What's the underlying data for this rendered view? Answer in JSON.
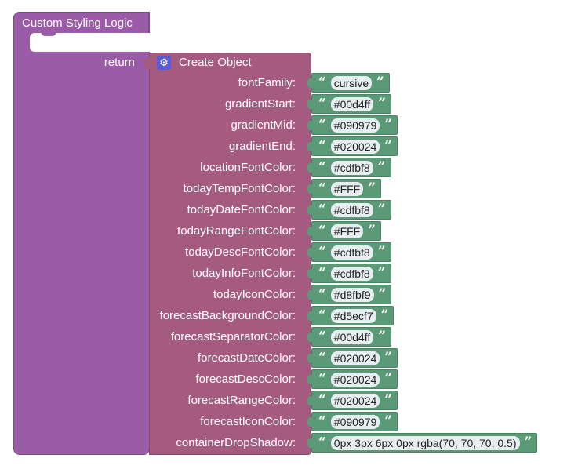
{
  "procedure": {
    "title": "Custom Styling Logic",
    "return_label": "return"
  },
  "object_block": {
    "title": "Create Object",
    "icon": "gear-icon"
  },
  "fields": [
    {
      "key": "fontFamily:",
      "value": "cursive"
    },
    {
      "key": "gradientStart:",
      "value": "#00d4ff"
    },
    {
      "key": "gradientMid:",
      "value": "#090979"
    },
    {
      "key": "gradientEnd:",
      "value": "#020024"
    },
    {
      "key": "locationFontColor:",
      "value": "#cdfbf8"
    },
    {
      "key": "todayTempFontColor:",
      "value": "#FFF"
    },
    {
      "key": "todayDateFontColor:",
      "value": "#cdfbf8"
    },
    {
      "key": "todayRangeFontColor:",
      "value": "#FFF"
    },
    {
      "key": "todayDescFontColor:",
      "value": "#cdfbf8"
    },
    {
      "key": "todayInfoFontColor:",
      "value": "#cdfbf8"
    },
    {
      "key": "todayIconColor:",
      "value": "#d8fbf9"
    },
    {
      "key": "forecastBackgroundColor:",
      "value": "#d5ecf7"
    },
    {
      "key": "forecastSeparatorColor:",
      "value": "#00d4ff"
    },
    {
      "key": "forecastDateColor:",
      "value": "#020024"
    },
    {
      "key": "forecastDescColor:",
      "value": "#020024"
    },
    {
      "key": "forecastRangeColor:",
      "value": "#020024"
    },
    {
      "key": "forecastIconColor:",
      "value": "#090979"
    },
    {
      "key": "containerDropShadow:",
      "value": "0px 3px 6px 0px rgba(70, 70, 70, 0.5)"
    }
  ],
  "colors": {
    "procedure_block": "#9a5ca6",
    "object_block": "#a55b80",
    "string_block": "#5b9a77"
  }
}
